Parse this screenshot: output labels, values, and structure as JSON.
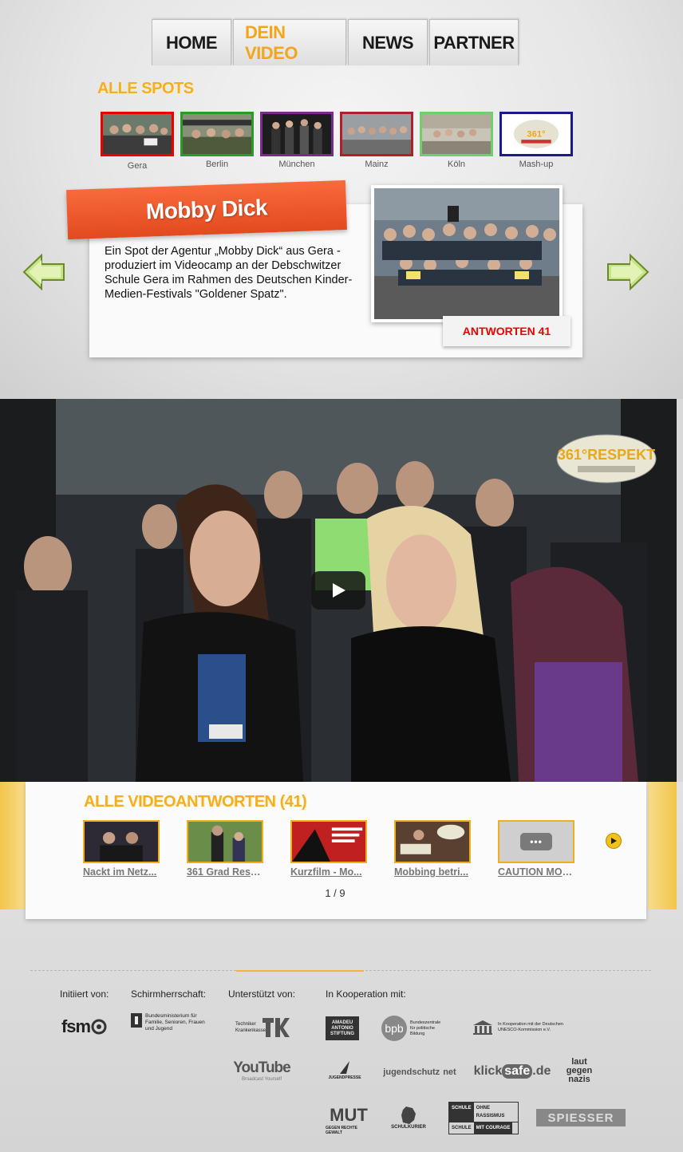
{
  "nav": {
    "tabs": [
      {
        "label": "HOME"
      },
      {
        "label": "DEIN VIDEO"
      },
      {
        "label": "NEWS"
      },
      {
        "label": "PARTNER"
      }
    ]
  },
  "spots": {
    "heading": "ALLE SPOTS",
    "items": [
      {
        "label": "Gera"
      },
      {
        "label": "Berlin"
      },
      {
        "label": "München"
      },
      {
        "label": "Mainz"
      },
      {
        "label": "Köln"
      },
      {
        "label": "Mash-up"
      }
    ]
  },
  "feature": {
    "title": "Mobby Dick",
    "description": "Ein Spot der Agentur „Mobby Dick“ aus Gera - produziert im Videocamp an der Debschwitzer Schule Gera im Rahmen des Deutschen Kinder-Medien-Festivals \"Goldener Spatz\".",
    "answers_button": "ANTWORTEN 41"
  },
  "responses": {
    "heading": "ALLE VIDEOANTWORTEN",
    "count": "(41)",
    "items": [
      {
        "title": "Nackt im Netz..."
      },
      {
        "title": "361 Grad Resp..."
      },
      {
        "title": "Kurzfilm - Mo..."
      },
      {
        "title": "Mobbing betri..."
      },
      {
        "title": "CAUTION MOB..."
      }
    ],
    "placeholder_dots": "•••",
    "pager": "1 / 9"
  },
  "footer": {
    "labels": {
      "initiiert": "Initiiert von:",
      "schirm": "Schirmherrschaft:",
      "unterstuetzt": "Unterstützt von:",
      "kooperation": "In Kooperation mit:"
    },
    "logos": {
      "fsm": "fsm",
      "bmfsfj": "Bundesministerium für Familie, Senioren, Frauen und Jugend",
      "tk": "Techniker Krankenkasse",
      "youtube": "YouTube",
      "youtube_sub": "Broadcast Yourself",
      "amadeu": "AMADEU ANTONIO STIFTUNG",
      "bpb": "bpb",
      "bpb_sub": "Bundeszentrale für politische Bildung",
      "unesco": "In Kooperation mit der Deutschen UNESCO-Kommission e.V.",
      "jugendpresse": "JUGENDPRESSE",
      "jugendschutz": "jugendschutz",
      "jugendschutz_net": "net",
      "klicksafe_a": "klick",
      "klicksafe_b": "safe",
      "klicksafe_c": ".de",
      "lauter": "laut gegen nazis",
      "mut": "MUT",
      "mut_sub": "GEGEN RECHTE GEWALT",
      "schulkurier": "SCHULKURIER",
      "sor_a": "SCHULE",
      "sor_b": "OHNE RASSISMUS",
      "sor_c": "SCHULE",
      "sor_d": "MIT COURAGE",
      "spiesser": "SPIESSER"
    }
  },
  "colors": {
    "accent": "#f5ae22",
    "ribbon": "#e24a1f",
    "answers_text": "#e00000"
  }
}
